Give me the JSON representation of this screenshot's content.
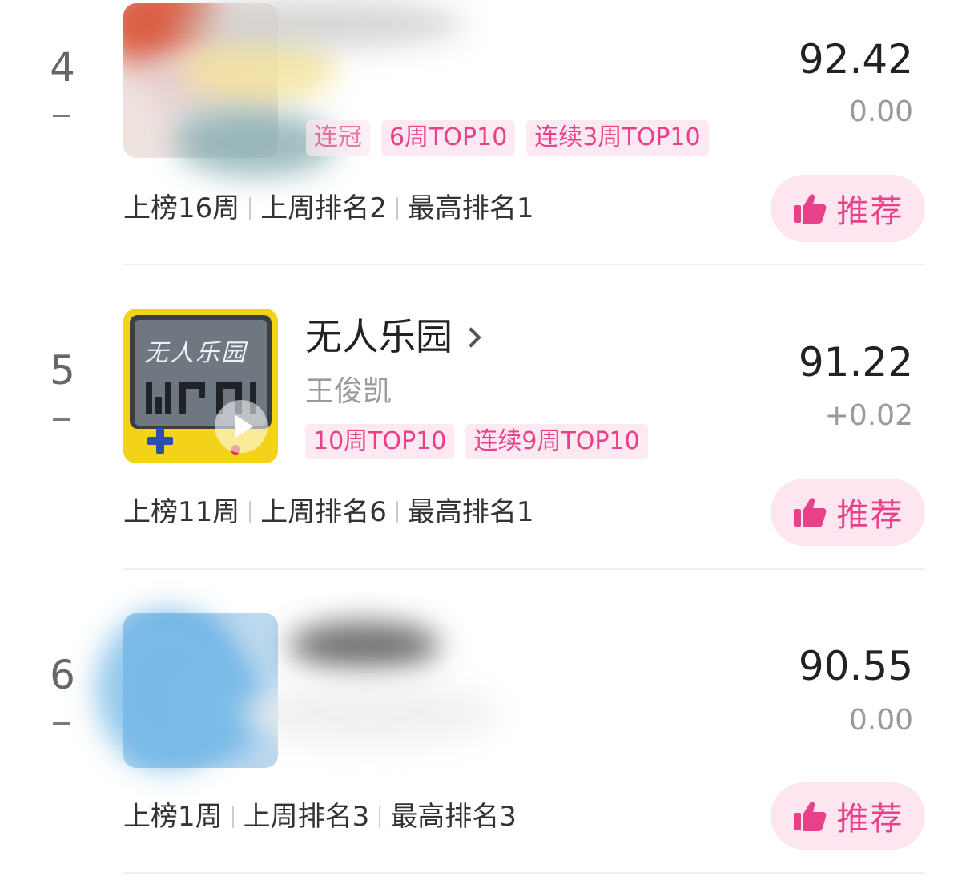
{
  "colors": {
    "accent": "#e8418a",
    "tag_bg": "#fde9f1",
    "button_bg": "#fde6ef"
  },
  "entries": [
    {
      "rank": "4",
      "trend": "–",
      "title": "",
      "artist": "",
      "tags": [
        "连冠",
        "6周TOP10",
        "连续3周TOP10"
      ],
      "score": "92.42",
      "delta": "0.00",
      "weeks": "上榜16周",
      "last_rank": "上周排名2",
      "peak": "最高排名1",
      "recommend_label": "推荐"
    },
    {
      "rank": "5",
      "trend": "–",
      "title": "无人乐园",
      "artist": "王俊凯",
      "cover_text": "无人乐园",
      "tags": [
        "10周TOP10",
        "连续9周TOP10"
      ],
      "score": "91.22",
      "delta": "+0.02",
      "weeks": "上榜11周",
      "last_rank": "上周排名6",
      "peak": "最高排名1",
      "recommend_label": "推荐"
    },
    {
      "rank": "6",
      "trend": "–",
      "title": "",
      "artist": "",
      "tags": [],
      "score": "90.55",
      "delta": "0.00",
      "weeks": "上榜1周",
      "last_rank": "上周排名3",
      "peak": "最高排名3",
      "recommend_label": "推荐"
    }
  ]
}
